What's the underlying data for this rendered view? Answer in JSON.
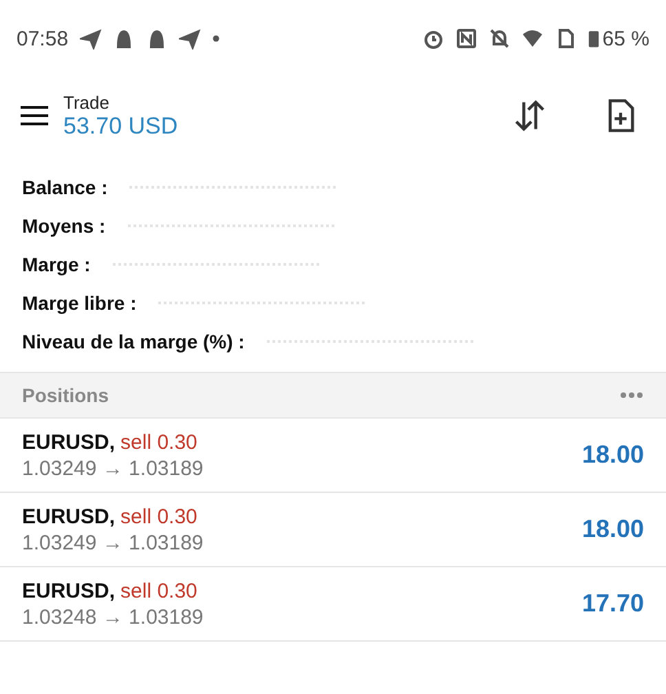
{
  "status_bar": {
    "time": "07:58",
    "battery": "65 %"
  },
  "header": {
    "title": "Trade",
    "balance": "53.70 USD"
  },
  "summary": [
    {
      "label": "Balance :"
    },
    {
      "label": "Moyens :"
    },
    {
      "label": "Marge :"
    },
    {
      "label": "Marge libre :"
    },
    {
      "label": "Niveau de la marge (%) :"
    }
  ],
  "positions": {
    "title": "Positions",
    "rows": [
      {
        "symbol": "EURUSD,",
        "side": "sell 0.30",
        "prices": "1.03249 → 1.03189",
        "profit": "18.00"
      },
      {
        "symbol": "EURUSD,",
        "side": "sell 0.30",
        "prices": "1.03249 → 1.03189",
        "profit": "18.00"
      },
      {
        "symbol": "EURUSD,",
        "side": "sell 0.30",
        "prices": "1.03248 → 1.03189",
        "profit": "17.70"
      }
    ]
  }
}
